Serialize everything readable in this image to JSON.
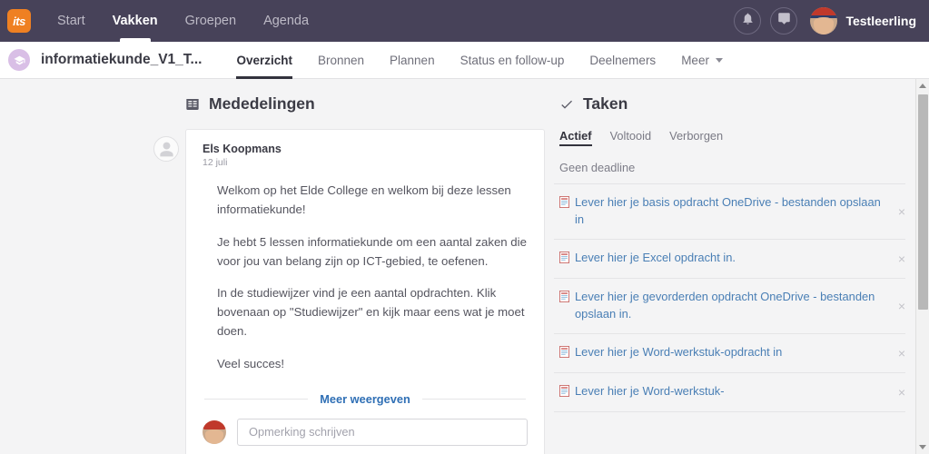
{
  "topnav": {
    "logo_text": "its",
    "items": [
      {
        "label": "Start",
        "active": false
      },
      {
        "label": "Vakken",
        "active": true
      },
      {
        "label": "Groepen",
        "active": false
      },
      {
        "label": "Agenda",
        "active": false
      }
    ],
    "notifications_icon": "bell-icon",
    "messages_icon": "chat-bubble-icon",
    "user_name": "Testleerling"
  },
  "subheader": {
    "course_icon": "graduation-cap-icon",
    "course_title": "informatiekunde_V1_T...",
    "tabs": [
      {
        "label": "Overzicht",
        "active": true
      },
      {
        "label": "Bronnen",
        "active": false
      },
      {
        "label": "Plannen",
        "active": false
      },
      {
        "label": "Status en follow-up",
        "active": false
      },
      {
        "label": "Deelnemers",
        "active": false
      },
      {
        "label": "Meer",
        "active": false,
        "has_caret": true
      }
    ]
  },
  "announcements": {
    "icon": "newspaper-icon",
    "title": "Mededelingen",
    "post": {
      "author": "Els Koopmans",
      "date": "12 juli",
      "paragraphs": [
        "Welkom op het Elde College en welkom bij deze lessen informatiekunde!",
        "Je hebt 5 lessen informatiekunde om een aantal zaken die voor jou van belang zijn op ICT-gebied, te oefenen.",
        "In de studiewijzer vind je een aantal opdrachten. Klik bovenaan op \"Studiewijzer\" en kijk maar eens wat je moet doen.",
        "Veel succes!"
      ],
      "show_more_label": "Meer weergeven",
      "comment_placeholder": "Opmerking schrijven"
    }
  },
  "tasks": {
    "icon": "check-icon",
    "title": "Taken",
    "tabs": [
      {
        "label": "Actief",
        "active": true
      },
      {
        "label": "Voltooid",
        "active": false
      },
      {
        "label": "Verborgen",
        "active": false
      }
    ],
    "group_label": "Geen deadline",
    "dismiss_label": "×",
    "items": [
      {
        "label": "Lever hier je basis opdracht OneDrive - bestanden opslaan in"
      },
      {
        "label": "Lever hier je Excel opdracht in."
      },
      {
        "label": "Lever hier je gevorderden opdracht OneDrive - bestanden opslaan in."
      },
      {
        "label": "Lever hier je Word-werkstuk-opdracht in"
      },
      {
        "label": "Lever hier je Word-werkstuk-"
      }
    ]
  },
  "colors": {
    "header_bg": "#474259",
    "logo_orange": "#ef8022",
    "link_blue": "#2f6fb5",
    "task_link_blue": "#4a7fb5",
    "page_bg": "#f4f4f5",
    "course_icon_purple": "#d9bfe6"
  }
}
